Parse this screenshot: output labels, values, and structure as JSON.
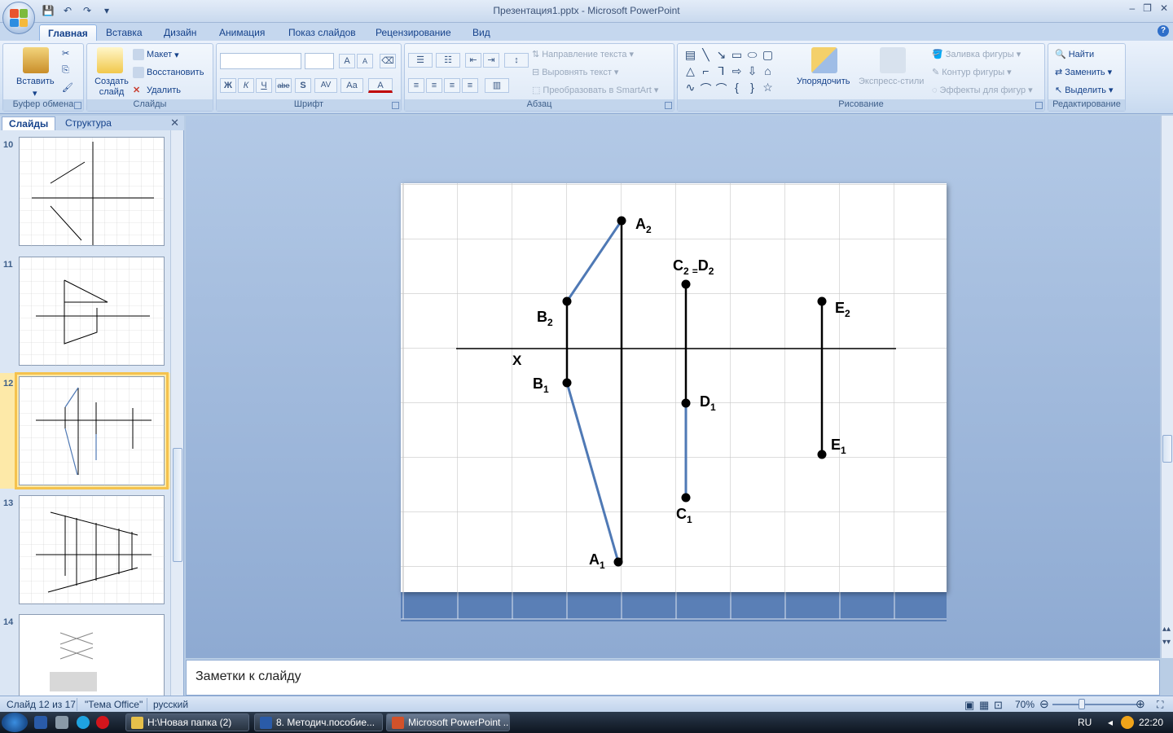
{
  "window": {
    "title": "Презентация1.pptx - Microsoft PowerPoint",
    "controls": [
      "–",
      "❐",
      "✕"
    ]
  },
  "ribbon_tabs": [
    "Главная",
    "Вставка",
    "Дизайн",
    "Анимация",
    "Показ слайдов",
    "Рецензирование",
    "Вид"
  ],
  "ribbon": {
    "clipboard": {
      "label": "Буфер обмена",
      "paste": "Вставить"
    },
    "slides": {
      "label": "Слайды",
      "new_slide": "Создать слайд",
      "layout": "Макет",
      "reset": "Восстановить",
      "delete": "Удалить"
    },
    "font": {
      "label": "Шрифт",
      "bold": "Ж",
      "italic": "К",
      "underline": "Ч",
      "strike": "abe",
      "shadow": "S",
      "spacing": "AV",
      "case": "Aa",
      "color": "A",
      "grow": "A",
      "shrink": "A"
    },
    "paragraph": {
      "label": "Абзац",
      "text_direction": "Направление текста",
      "align_text": "Выровнять текст",
      "smartart": "Преобразовать в SmartArt"
    },
    "drawing": {
      "label": "Рисование",
      "arrange": "Упорядочить",
      "quick_styles": "Экспресс-стили",
      "fill": "Заливка фигуры",
      "outline": "Контур фигуры",
      "effects": "Эффекты для фигур"
    },
    "editing": {
      "label": "Редактирование",
      "find": "Найти",
      "replace": "Заменить",
      "select": "Выделить"
    }
  },
  "left_panel": {
    "tabs": [
      "Слайды",
      "Структура"
    ],
    "thumbnails": [
      {
        "num": "10"
      },
      {
        "num": "11"
      },
      {
        "num": "12",
        "selected": true
      },
      {
        "num": "13"
      },
      {
        "num": "14"
      }
    ]
  },
  "slide": {
    "x_label": "X",
    "points": {
      "A2": {
        "base": "A",
        "sub": "2"
      },
      "B2": {
        "base": "B",
        "sub": "2"
      },
      "C2D2": {
        "base1": "C",
        "sub1": "2",
        "eq": "=",
        "base2": "D",
        "sub2": "2"
      },
      "E2": {
        "base": "E",
        "sub": "2"
      },
      "B1": {
        "base": "B",
        "sub": "1"
      },
      "D1": {
        "base": "D",
        "sub": "1"
      },
      "E1": {
        "base": "E",
        "sub": "1"
      },
      "C1": {
        "base": "C",
        "sub": "1"
      },
      "A1": {
        "base": "A",
        "sub": "1"
      }
    }
  },
  "notes": {
    "placeholder": "Заметки к слайду"
  },
  "status": {
    "slide_info": "Слайд 12 из 17",
    "theme": "\"Тема Office\"",
    "language": "русский",
    "zoom": "70%"
  },
  "taskbar": {
    "tasks": [
      "H:\\Новая папка (2)",
      "8. Методич.пособие...",
      "Microsoft PowerPoint ..."
    ],
    "lang": "RU",
    "time": "22:20"
  },
  "colors": {
    "blue_line": "#4f79b5",
    "black_line": "#000000",
    "accent": "#15428b"
  }
}
